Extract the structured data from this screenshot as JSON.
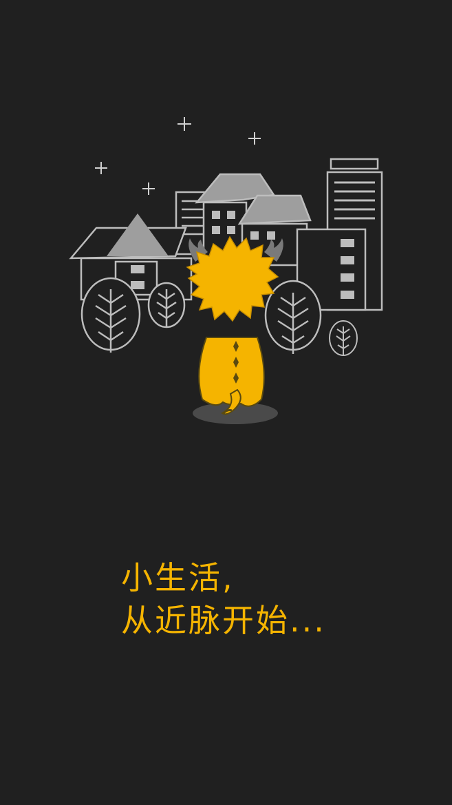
{
  "splash": {
    "tagline_line1": "小生活,",
    "tagline_line2": "从近脉开始..."
  },
  "colors": {
    "background": "#202020",
    "accent": "#f5b400",
    "line_art": "#bdbdbd",
    "fill_gray": "#9e9e9e"
  },
  "illustration": {
    "icons": [
      "moon-icon",
      "star-icon",
      "house-icon",
      "building-icon",
      "tree-icon",
      "mascot-icon"
    ]
  }
}
